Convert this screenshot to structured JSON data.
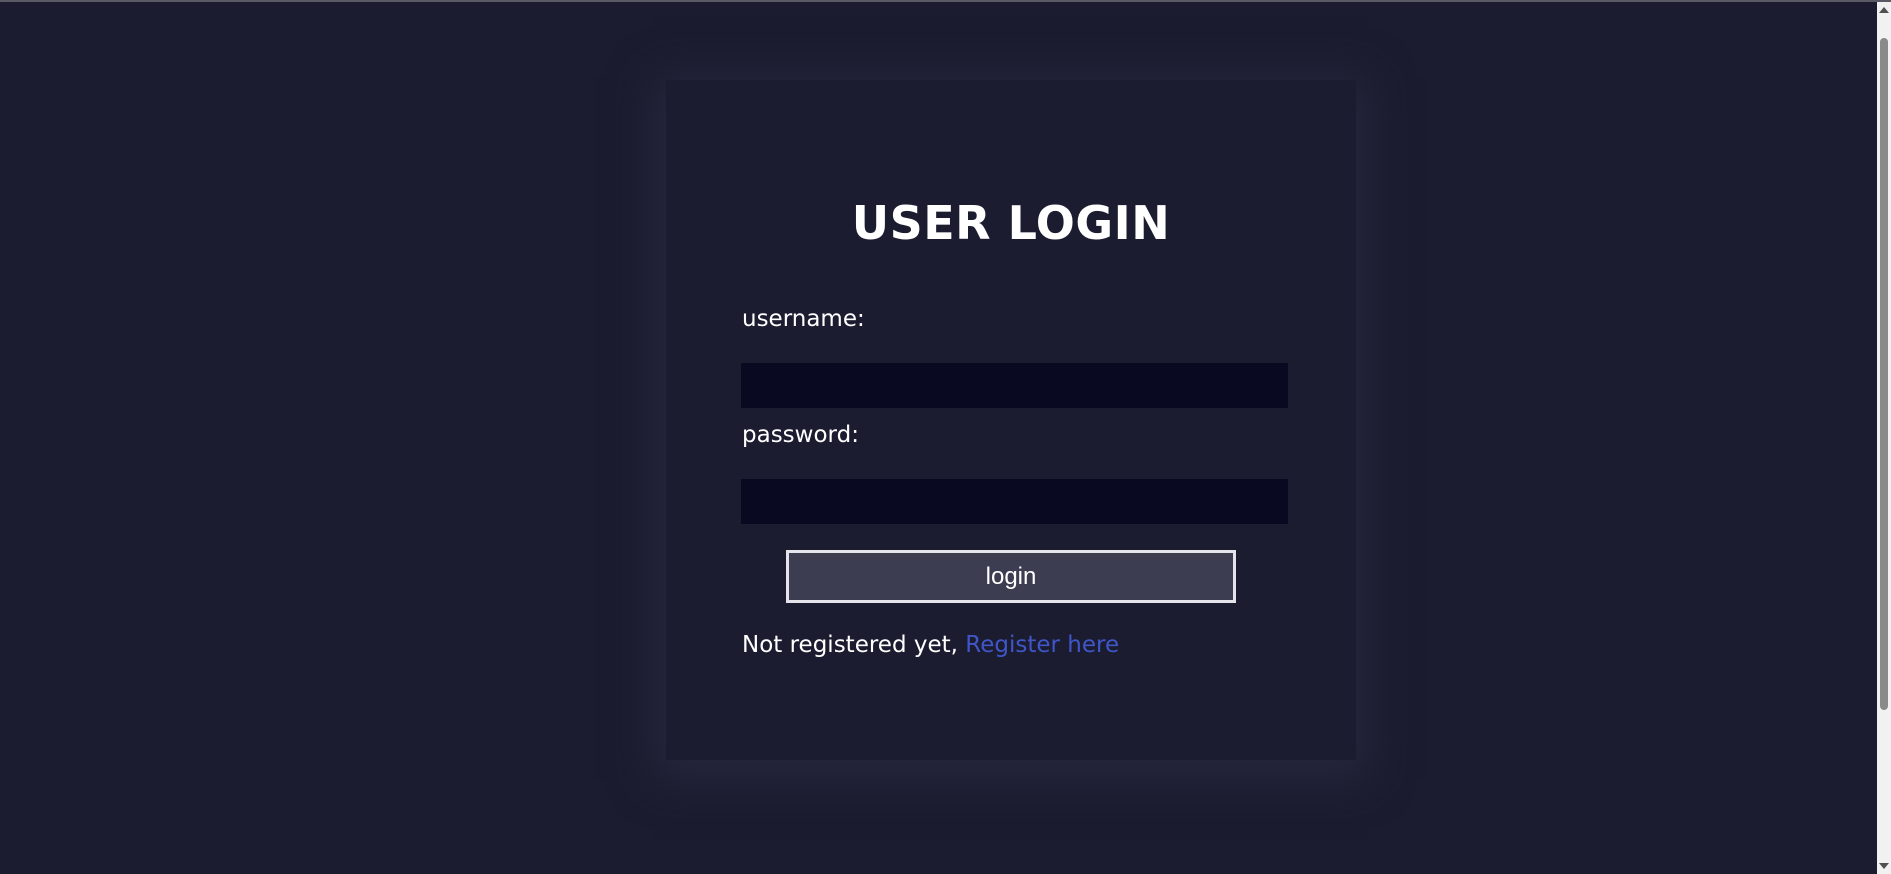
{
  "login_form": {
    "title": "USER LOGIN",
    "username_label": "username:",
    "username_value": "",
    "password_label": "password:",
    "password_value": "",
    "login_button_label": "login",
    "register_prompt": "Not registered yet, ",
    "register_link_label": "Register here"
  },
  "colors": {
    "page_background": "#1c1c30",
    "input_background": "#090a22",
    "button_background": "#3d3d52",
    "link_color": "#3f56c8",
    "text_color": "#ffffff"
  },
  "icons": {
    "scroll_up": "chevron-up-icon",
    "scroll_down": "chevron-down-icon"
  }
}
